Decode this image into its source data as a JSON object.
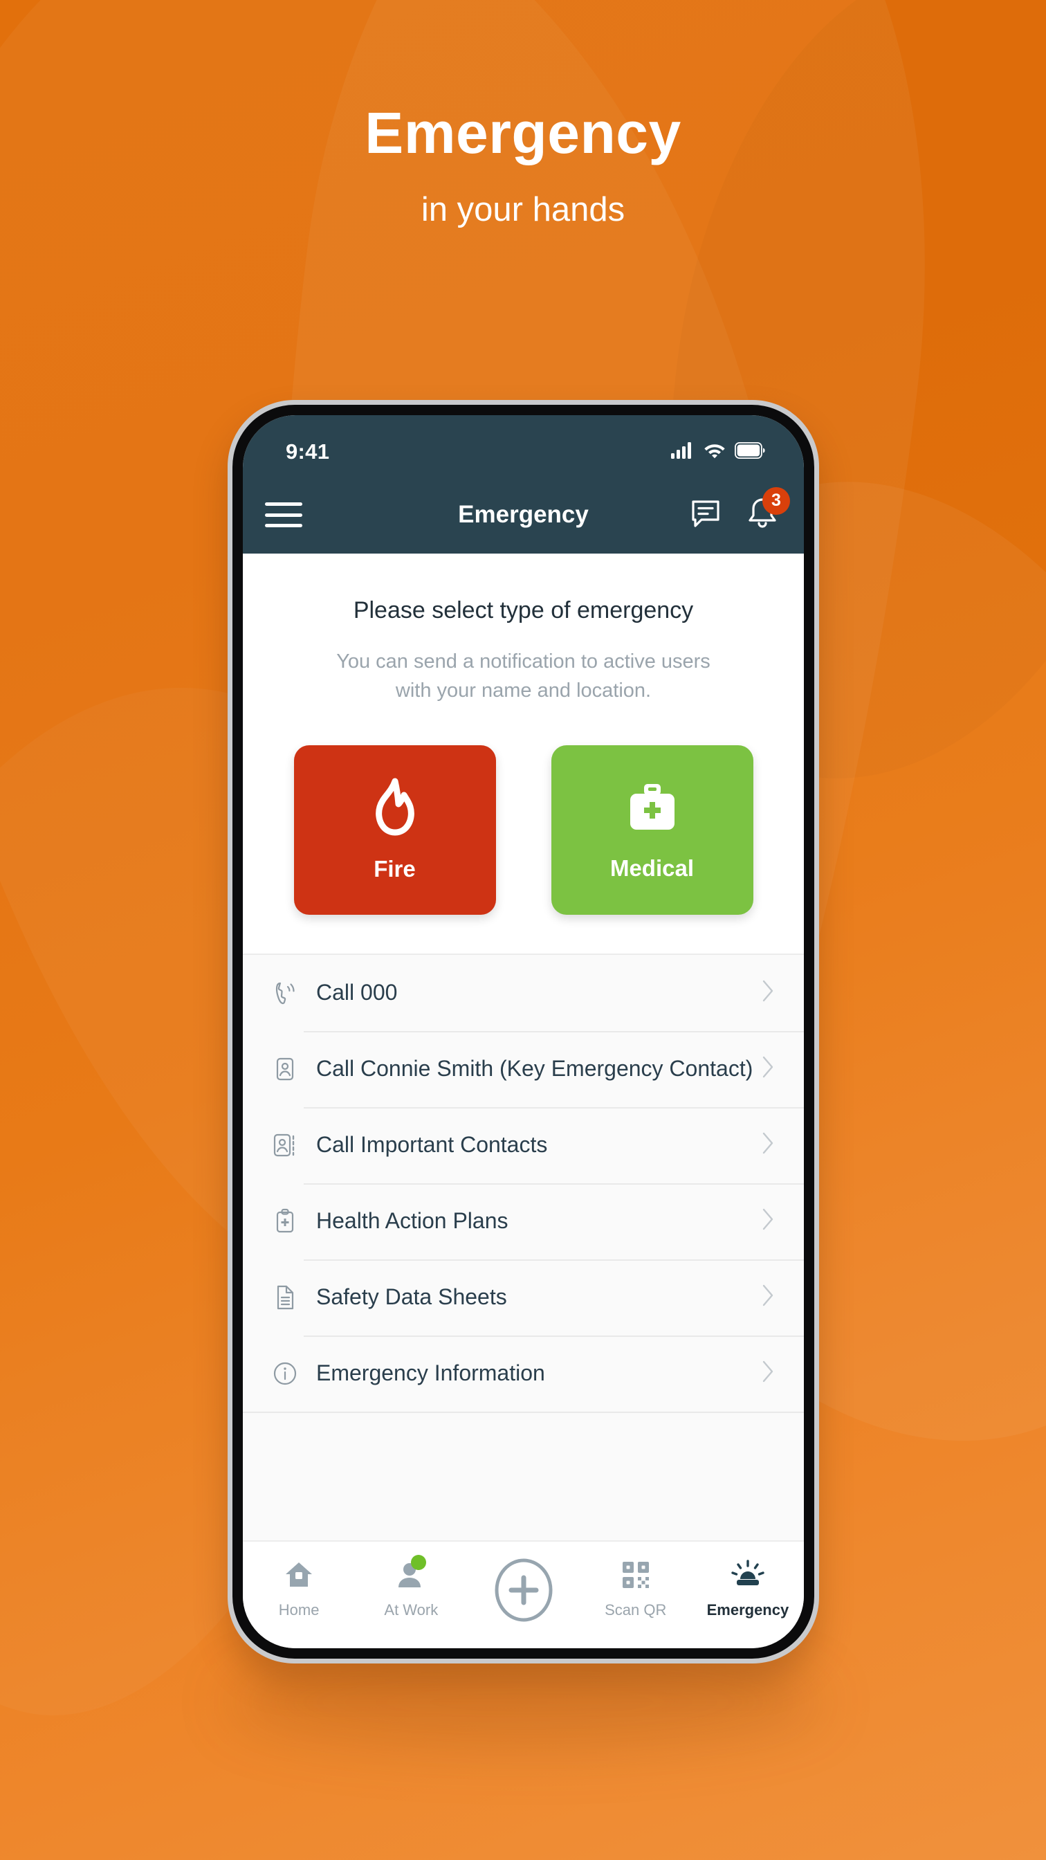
{
  "hero": {
    "title": "Emergency",
    "subtitle": "in your hands"
  },
  "colors": {
    "background_orange": "#E2700C",
    "background_orange_bottom": "#F0913C",
    "appbar_dark": "#2A4450",
    "fire_red": "#CE3314",
    "medical_green": "#7CC242",
    "badge_red": "#D9400B",
    "status_dot_green": "#6FBF29",
    "text_dark": "#2A3E4C",
    "text_muted": "#9AA4AC"
  },
  "phone": {
    "statusbar": {
      "time": "9:41",
      "icons": [
        "cellular-signal-icon",
        "wifi-icon",
        "battery-icon"
      ]
    },
    "appbar": {
      "menu_icon": "hamburger-menu-icon",
      "title": "Emergency",
      "actions": [
        {
          "icon": "chat-message-icon",
          "badge": null
        },
        {
          "icon": "notification-bell-icon",
          "badge": "3"
        }
      ]
    },
    "content": {
      "heading": "Please select type of emergency",
      "description_line1": "You can send a notification to active users",
      "description_line2": "with your name and location.",
      "emergency_types": [
        {
          "label": "Fire",
          "icon": "flame-icon",
          "color": "#CE3314"
        },
        {
          "label": "Medical",
          "icon": "first-aid-kit-icon",
          "color": "#7CC242"
        }
      ]
    },
    "list": [
      {
        "label": "Call 000",
        "icon": "phone-ringing-icon"
      },
      {
        "label": "Call Connie Smith (Key Emergency Contact)",
        "icon": "contact-card-icon"
      },
      {
        "label": "Call Important Contacts",
        "icon": "contacts-list-icon"
      },
      {
        "label": "Health Action Plans",
        "icon": "clipboard-medical-icon"
      },
      {
        "label": "Safety Data Sheets",
        "icon": "document-icon"
      },
      {
        "label": "Emergency Information",
        "icon": "info-circle-icon"
      }
    ],
    "tabs": [
      {
        "label": "Home",
        "icon": "home-icon",
        "active": false,
        "dot": false
      },
      {
        "label": "At Work",
        "icon": "person-icon",
        "active": false,
        "dot": true
      },
      {
        "label": "Scan QR",
        "icon": "qr-code-icon",
        "active": false,
        "dot": false
      },
      {
        "label": "Emergency",
        "icon": "siren-icon",
        "active": true,
        "dot": false
      }
    ],
    "add_button": {
      "icon": "plus-circle-icon"
    }
  }
}
